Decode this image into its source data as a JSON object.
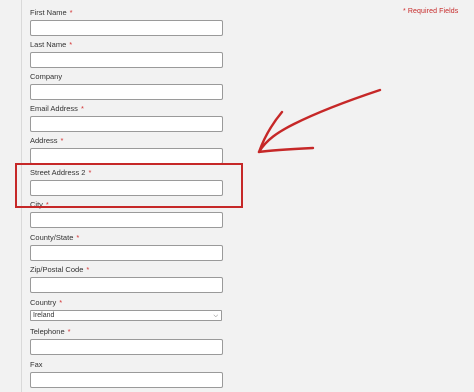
{
  "required_note": {
    "star": "*",
    "text": "Required Fields"
  },
  "fields": {
    "first_name": {
      "label": "First Name",
      "required": "*"
    },
    "last_name": {
      "label": "Last Name",
      "required": "*"
    },
    "company": {
      "label": "Company"
    },
    "email": {
      "label": "Email Address",
      "required": "*"
    },
    "address": {
      "label": "Address",
      "required": "*"
    },
    "street2": {
      "label": "Street Address 2",
      "required": "*"
    },
    "city": {
      "label": "City",
      "required": "*"
    },
    "county": {
      "label": "County/State",
      "required": "*"
    },
    "zip": {
      "label": "Zip/Postal Code",
      "required": "*"
    },
    "country": {
      "label": "Country",
      "required": "*",
      "value": "Ireland"
    },
    "telephone": {
      "label": "Telephone",
      "required": "*"
    },
    "fax": {
      "label": "Fax"
    }
  },
  "colors": {
    "accent": "#c62828",
    "border": "#9a9a9a",
    "background": "#f2f2f2"
  },
  "icons": {
    "select": "chevron-down-icon"
  }
}
